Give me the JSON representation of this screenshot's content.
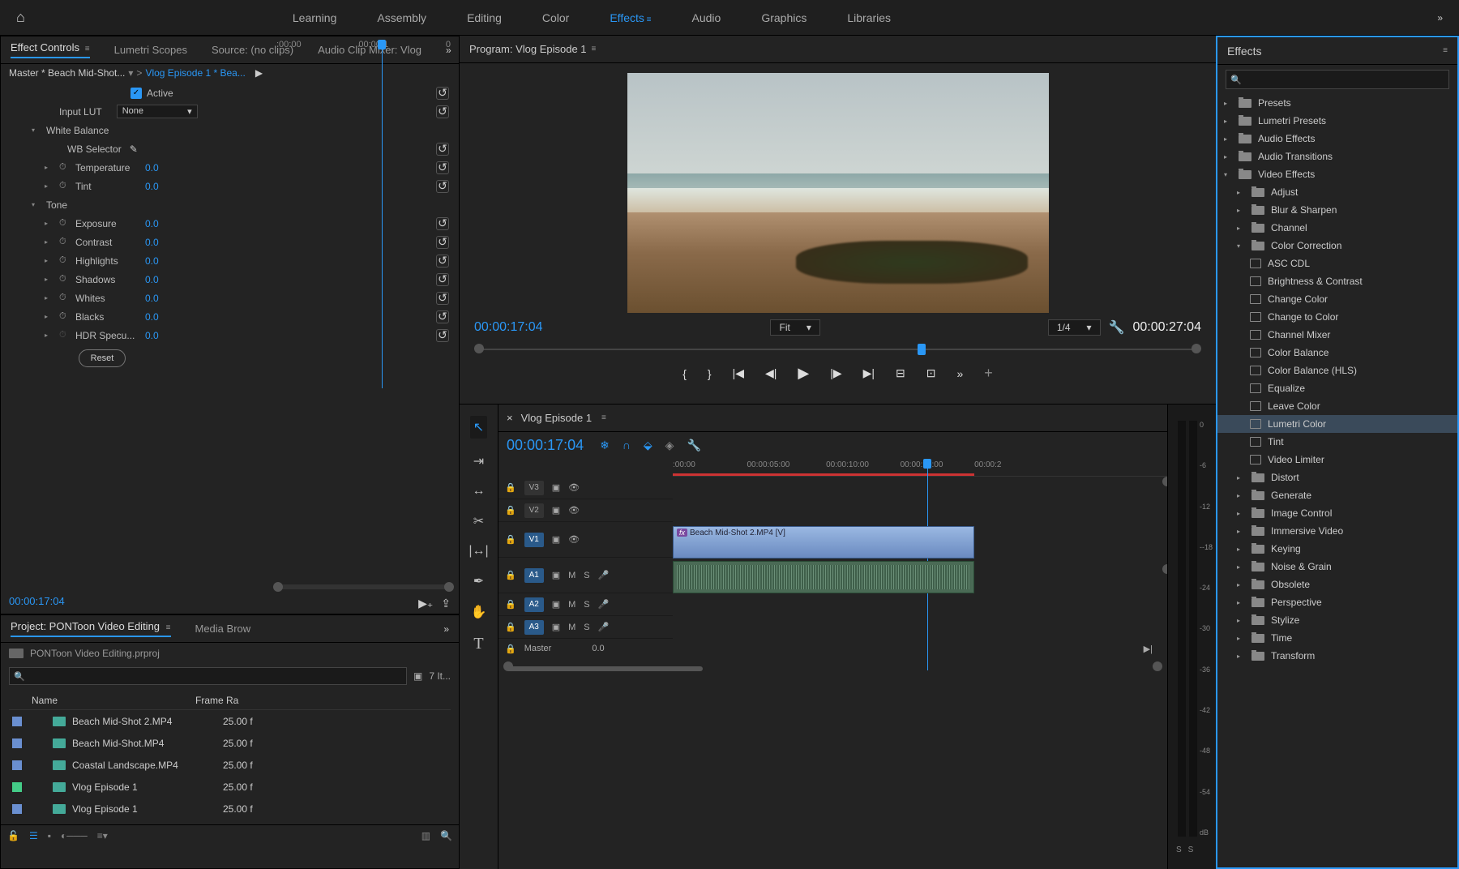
{
  "workspace_tabs": [
    "Learning",
    "Assembly",
    "Editing",
    "Color",
    "Effects",
    "Audio",
    "Graphics",
    "Libraries"
  ],
  "workspace_active": "Effects",
  "left_panel_tabs": [
    "Effect Controls",
    "Lumetri Scopes",
    "Source: (no clips)",
    "Audio Clip Mixer: Vlog"
  ],
  "ec": {
    "master": "Master * Beach Mid-Shot...",
    "seq": "Vlog Episode 1 * Bea...",
    "ruler": [
      ":00:00",
      "00:00:1",
      "0"
    ],
    "active_label": "Active",
    "input_lut_label": "Input LUT",
    "input_lut_value": "None",
    "wb_label": "White Balance",
    "wb_sel_label": "WB Selector",
    "tone_label": "Tone",
    "params": [
      {
        "label": "Temperature",
        "value": "0.0"
      },
      {
        "label": "Tint",
        "value": "0.0"
      }
    ],
    "tone_params": [
      {
        "label": "Exposure",
        "value": "0.0"
      },
      {
        "label": "Contrast",
        "value": "0.0"
      },
      {
        "label": "Highlights",
        "value": "0.0"
      },
      {
        "label": "Shadows",
        "value": "0.0"
      },
      {
        "label": "Whites",
        "value": "0.0"
      },
      {
        "label": "Blacks",
        "value": "0.0"
      },
      {
        "label": "HDR Specu...",
        "value": "0.0"
      }
    ],
    "reset_label": "Reset",
    "tc": "00:00:17:04"
  },
  "project": {
    "tabs": [
      "Project: PONToon Video Editing",
      "Media Brow"
    ],
    "file": "PONToon Video Editing.prproj",
    "count": "7 It...",
    "cols": [
      "Name",
      "Frame Ra"
    ],
    "items": [
      {
        "name": "Beach Mid-Shot 2.MP4",
        "rate": "25.00 f",
        "swatch": "#6a8fd0"
      },
      {
        "name": "Beach Mid-Shot.MP4",
        "rate": "25.00 f",
        "swatch": "#6a8fd0"
      },
      {
        "name": "Coastal Landscape.MP4",
        "rate": "25.00 f",
        "swatch": "#6a8fd0"
      },
      {
        "name": "Vlog Episode 1",
        "rate": "25.00 f",
        "swatch": "#4c8"
      },
      {
        "name": "Vlog Episode 1",
        "rate": "25.00 f",
        "swatch": "#6a8fd0"
      }
    ]
  },
  "program": {
    "title": "Program: Vlog Episode 1",
    "tc": "00:00:17:04",
    "fit": "Fit",
    "quality": "1/4",
    "dur": "00:00:27:04"
  },
  "timeline": {
    "seq": "Vlog Episode 1",
    "tc": "00:00:17:04",
    "ticks": [
      ":00:00",
      "00:00:05:00",
      "00:00:10:00",
      "00:00:15:00",
      "00:00:2"
    ],
    "vtracks": [
      "V3",
      "V2",
      "V1"
    ],
    "atracks": [
      "A1",
      "A2",
      "A3"
    ],
    "clip_name": "Beach Mid-Shot 2.MP4 [V]",
    "master_label": "Master",
    "master_val": "0.0"
  },
  "meter_ticks": [
    "0",
    "-6",
    "-12",
    "--18",
    "-24",
    "-30",
    "-36",
    "-42",
    "-48",
    "-54",
    "dB"
  ],
  "effects": {
    "title": "Effects",
    "root": [
      {
        "label": "Presets",
        "open": false
      },
      {
        "label": "Lumetri Presets",
        "open": false
      },
      {
        "label": "Audio Effects",
        "open": false
      },
      {
        "label": "Audio Transitions",
        "open": false
      }
    ],
    "video_effects_label": "Video Effects",
    "ve_children": [
      {
        "label": "Adjust"
      },
      {
        "label": "Blur & Sharpen"
      },
      {
        "label": "Channel"
      }
    ],
    "cc_label": "Color Correction",
    "cc_items": [
      "ASC CDL",
      "Brightness & Contrast",
      "Change Color",
      "Change to Color",
      "Channel Mixer",
      "Color Balance",
      "Color Balance (HLS)",
      "Equalize",
      "Leave Color",
      "Lumetri Color",
      "Tint",
      "Video Limiter"
    ],
    "cc_selected": "Lumetri Color",
    "ve_rest": [
      "Distort",
      "Generate",
      "Image Control",
      "Immersive Video",
      "Keying",
      "Noise & Grain",
      "Obsolete",
      "Perspective",
      "Stylize",
      "Time",
      "Transform"
    ]
  }
}
